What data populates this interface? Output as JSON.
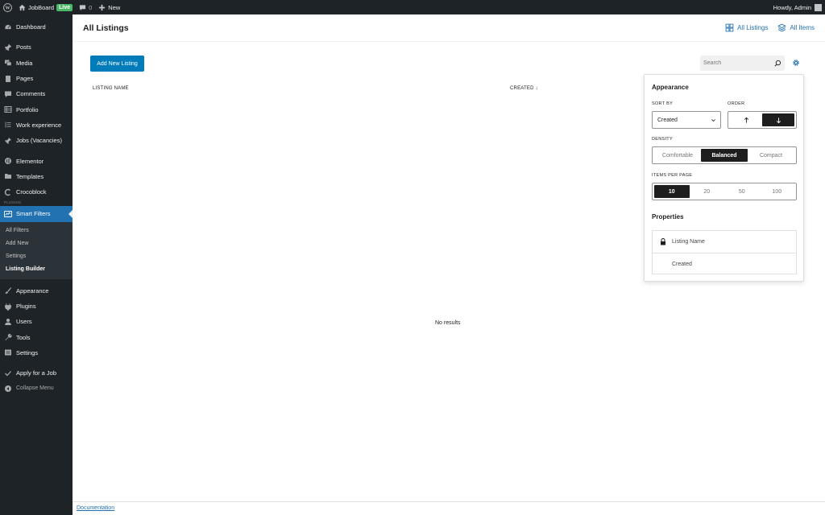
{
  "admin_bar": {
    "site_name": "JobBoard",
    "live_badge": "Live",
    "comments_count": "0",
    "new_label": "New",
    "howdy": "Howdy, Admin"
  },
  "sidebar": {
    "items_top": [
      {
        "label": "Dashboard",
        "icon": "dashboard-icon"
      },
      {
        "label": "Posts",
        "icon": "pin-icon"
      },
      {
        "label": "Media",
        "icon": "media-icon"
      },
      {
        "label": "Pages",
        "icon": "page-icon"
      },
      {
        "label": "Comments",
        "icon": "comment-icon"
      },
      {
        "label": "Portfolio",
        "icon": "portfolio-icon"
      },
      {
        "label": "Work experience",
        "icon": "list-icon"
      },
      {
        "label": "Jobs (Vacancies)",
        "icon": "jobs-icon"
      },
      {
        "label": "Elementor",
        "icon": "elementor-icon"
      },
      {
        "label": "Templates",
        "icon": "folder-icon"
      },
      {
        "label": "Crocoblock",
        "icon": "crocoblock-icon"
      }
    ],
    "plugins_sep": "PLUGINS",
    "active_item": "Smart Filters",
    "submenu": [
      "All Filters",
      "Add New",
      "Settings",
      "Listing Builder"
    ],
    "items_bottom": [
      {
        "label": "Appearance",
        "icon": "brush-icon"
      },
      {
        "label": "Plugins",
        "icon": "plugin-icon"
      },
      {
        "label": "Users",
        "icon": "user-icon"
      },
      {
        "label": "Tools",
        "icon": "wrench-icon"
      },
      {
        "label": "Settings",
        "icon": "settings-icon"
      }
    ],
    "apply_job": "Apply for a Job",
    "collapse": "Collapse Menu"
  },
  "header": {
    "title": "All Listings",
    "link_listings": "All Listings",
    "link_items": "All Items"
  },
  "toolbar": {
    "add_new": "Add New Listing",
    "search_placeholder": "Search"
  },
  "table": {
    "col_name": "LISTING NAME",
    "col_created": "CREATED ↓",
    "empty": "No results"
  },
  "appearance": {
    "title": "Appearance",
    "sort_by_label": "SORT BY",
    "sort_by_value": "Created",
    "order_label": "ORDER",
    "density_label": "DENSITY",
    "density_options": [
      "Comfortable",
      "Balanced",
      "Compact"
    ],
    "density_selected": "Balanced",
    "items_per_page_label": "ITEMS PER PAGE",
    "items_per_page_options": [
      "10",
      "20",
      "50",
      "100"
    ],
    "items_per_page_selected": "10",
    "properties_title": "Properties",
    "properties": [
      "Listing Name",
      "Created"
    ]
  },
  "footer": {
    "documentation": "Documentation"
  }
}
